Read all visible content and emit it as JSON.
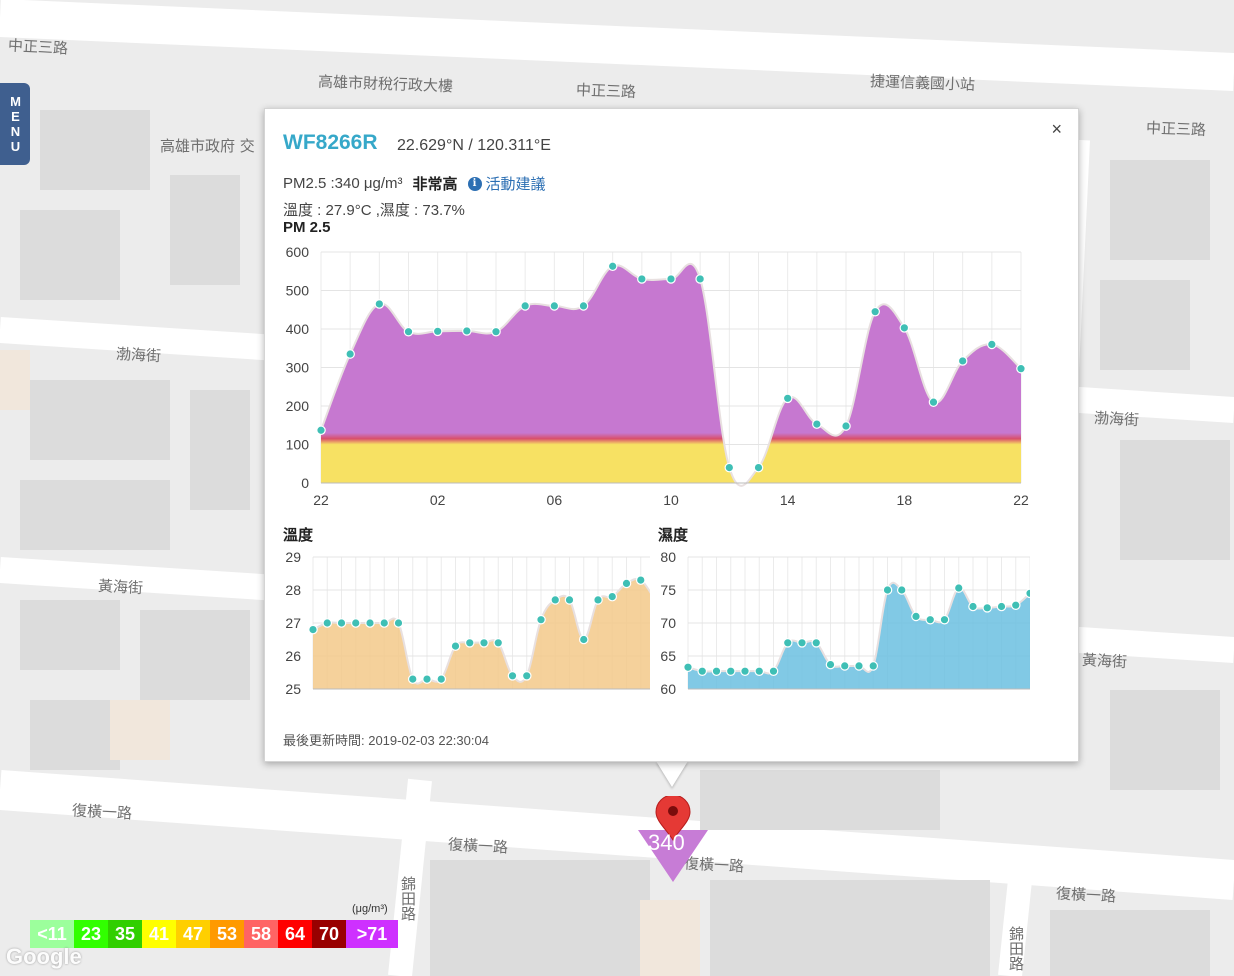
{
  "map": {
    "streets": [
      {
        "name": "中正三路",
        "id": "s1"
      },
      {
        "name": "高雄市財稅行政大樓",
        "id": "s2"
      },
      {
        "name": "中正三路",
        "id": "s3"
      },
      {
        "name": "捷運信義國小站",
        "id": "s4"
      },
      {
        "name": "高雄市政府 交",
        "id": "s5"
      },
      {
        "name": "中正三路",
        "id": "s6"
      },
      {
        "name": "渤海街",
        "id": "s7"
      },
      {
        "name": "渤海街",
        "id": "s8"
      },
      {
        "name": "黃海街",
        "id": "s9"
      },
      {
        "name": "黃海街",
        "id": "s10"
      },
      {
        "name": "復橫一路",
        "id": "s11"
      },
      {
        "name": "復橫一路",
        "id": "s12"
      },
      {
        "name": "復橫一路",
        "id": "s13"
      },
      {
        "name": "復橫一路",
        "id": "s14"
      },
      {
        "name": "錦田路",
        "id": "s15"
      },
      {
        "name": "錦田路",
        "id": "s16"
      }
    ],
    "google_label": "Google"
  },
  "menu": {
    "label": "MENU"
  },
  "info_window": {
    "station_id": "WF8266R",
    "coords": "22.629°N / 120.311°E",
    "close_label": "×",
    "pm_text": "PM2.5 :340 μg/m³",
    "pm_level": "非常高",
    "info_icon_glyph": "i",
    "advice_link": "活動建議",
    "temp_humidity_text": "溫度 : 27.9°C ,濕度 : 73.7%",
    "pm_chart_title": "PM 2.5",
    "temp_chart_title": "溫度",
    "humidity_chart_title": "濕度",
    "updated": "最後更新時間: 2019-02-03 22:30:04"
  },
  "marker": {
    "value": "340",
    "color": "#c77cd6"
  },
  "legend": {
    "unit": "(μg/m³)",
    "cells": [
      {
        "label": "<11",
        "color": "#9cff9c"
      },
      {
        "label": "23",
        "color": "#31ff00"
      },
      {
        "label": "35",
        "color": "#31cf00"
      },
      {
        "label": "41",
        "color": "#ffff00"
      },
      {
        "label": "47",
        "color": "#ffcf00"
      },
      {
        "label": "53",
        "color": "#ff9a00"
      },
      {
        "label": "58",
        "color": "#ff6464"
      },
      {
        "label": "64",
        "color": "#ff0000"
      },
      {
        "label": "70",
        "color": "#990000"
      },
      {
        "label": ">71",
        "color": "#ce30ff"
      }
    ]
  },
  "chart_data": [
    {
      "type": "area",
      "title": "PM 2.5",
      "x_ticks": [
        "22",
        "02",
        "06",
        "10",
        "14",
        "18",
        "22"
      ],
      "y_ticks": [
        "0",
        "100",
        "200",
        "300",
        "400",
        "500",
        "600"
      ],
      "ylim": [
        0,
        600
      ],
      "values": [
        137,
        335,
        465,
        393,
        394,
        395,
        393,
        460,
        460,
        460,
        563,
        530,
        530,
        530,
        40,
        40,
        220,
        153,
        148,
        445,
        403,
        210,
        317,
        360,
        297
      ],
      "fill_upper": "#c678d0",
      "fill_lower": "#f7e163",
      "grid": true
    },
    {
      "type": "area",
      "title": "溫度",
      "y_ticks": [
        "25",
        "26",
        "27",
        "28",
        "29"
      ],
      "ylim": [
        25,
        29
      ],
      "values": [
        26.8,
        27.0,
        27.0,
        27.0,
        27.0,
        27.0,
        27.0,
        25.3,
        25.3,
        25.3,
        26.3,
        26.4,
        26.4,
        26.4,
        25.4,
        25.4,
        27.1,
        27.7,
        27.7,
        26.5,
        27.7,
        27.8,
        28.2,
        28.3,
        27.7
      ],
      "fill": "#f3c98a",
      "grid": true
    },
    {
      "type": "area",
      "title": "濕度",
      "y_ticks": [
        "60",
        "65",
        "70",
        "75",
        "80"
      ],
      "ylim": [
        60,
        80
      ],
      "values": [
        63.3,
        62.7,
        62.7,
        62.7,
        62.7,
        62.7,
        62.7,
        67.0,
        67.0,
        67.0,
        63.7,
        63.5,
        63.5,
        63.5,
        75.0,
        75.0,
        71.0,
        70.5,
        70.5,
        75.3,
        72.5,
        72.3,
        72.5,
        72.7,
        74.5
      ],
      "fill": "#6bbfe0",
      "grid": true
    }
  ]
}
